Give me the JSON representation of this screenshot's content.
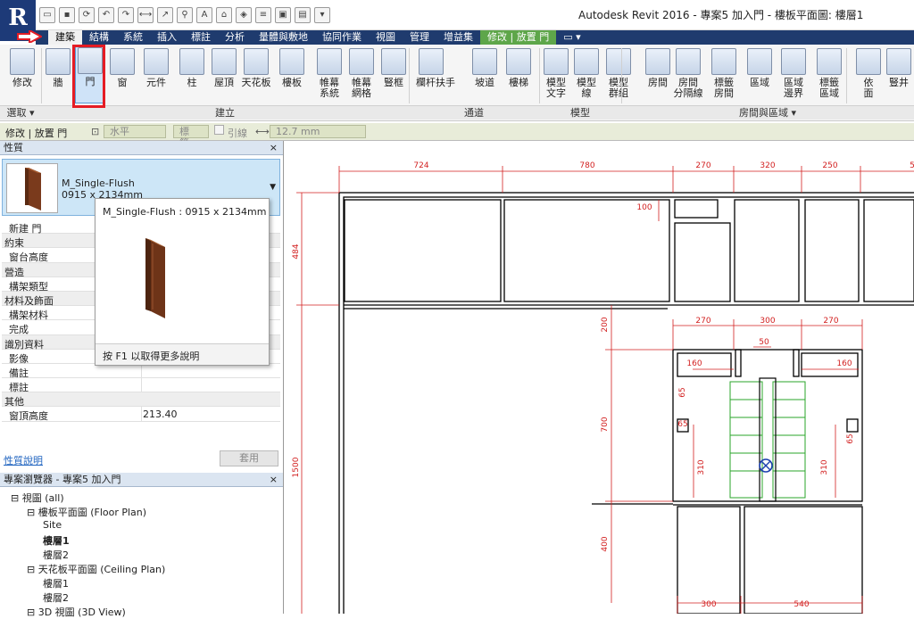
{
  "app": {
    "logo": "R",
    "window_title": "Autodesk Revit 2016 -   專案5 加入門 - 樓板平面圖: 樓層1"
  },
  "quick_access": [
    {
      "name": "open-icon",
      "glyph": "▭"
    },
    {
      "name": "save-icon",
      "glyph": "▪"
    },
    {
      "name": "sync-icon",
      "glyph": "⟳"
    },
    {
      "name": "undo-icon",
      "glyph": "↶"
    },
    {
      "name": "redo-icon",
      "glyph": "↷"
    },
    {
      "name": "measure-icon",
      "glyph": "⟷"
    },
    {
      "name": "dimension-icon",
      "glyph": "↗"
    },
    {
      "name": "tag-icon",
      "glyph": "⚲"
    },
    {
      "name": "text-icon",
      "glyph": "A"
    },
    {
      "name": "3d-icon",
      "glyph": "⌂"
    },
    {
      "name": "section-icon",
      "glyph": "◈"
    },
    {
      "name": "thin-lines-icon",
      "glyph": "≡"
    },
    {
      "name": "close-windows-icon",
      "glyph": "▣"
    },
    {
      "name": "switch-windows-icon",
      "glyph": "▤"
    },
    {
      "name": "customize-icon",
      "glyph": "▾"
    }
  ],
  "tabs": [
    "建築",
    "結構",
    "系統",
    "插入",
    "標註",
    "分析",
    "量體與敷地",
    "協同作業",
    "視圖",
    "管理",
    "增益集",
    "修改 | 放置 門",
    "▭ ▾"
  ],
  "ribbon": {
    "buttons": [
      {
        "id": "modify",
        "label": "修改"
      },
      {
        "id": "wall",
        "label": "牆"
      },
      {
        "id": "door",
        "label": "門"
      },
      {
        "id": "window",
        "label": "窗"
      },
      {
        "id": "component",
        "label": "元件"
      },
      {
        "id": "column",
        "label": "柱"
      },
      {
        "id": "roof",
        "label": "屋頂"
      },
      {
        "id": "ceiling",
        "label": "天花板"
      },
      {
        "id": "floor",
        "label": "樓板"
      },
      {
        "id": "curtain-system",
        "label": "帷幕\n系統"
      },
      {
        "id": "curtain-grid",
        "label": "帷幕\n網格"
      },
      {
        "id": "mullion",
        "label": "豎框"
      },
      {
        "id": "railing",
        "label": "欄杆扶手"
      },
      {
        "id": "ramp",
        "label": "坡道"
      },
      {
        "id": "stair",
        "label": "樓梯"
      },
      {
        "id": "model-text",
        "label": "模型\n文字"
      },
      {
        "id": "model-line",
        "label": "模型\n線"
      },
      {
        "id": "model-group",
        "label": "模型\n群組"
      },
      {
        "id": "room",
        "label": "房間"
      },
      {
        "id": "room-separator",
        "label": "房間\n分隔線"
      },
      {
        "id": "tag-room",
        "label": "標籤\n房間"
      },
      {
        "id": "area",
        "label": "區域"
      },
      {
        "id": "area-boundary",
        "label": "區域\n邊界"
      },
      {
        "id": "tag-area",
        "label": "標籤\n區域"
      },
      {
        "id": "by-face",
        "label": "依\n面"
      },
      {
        "id": "shaft",
        "label": "豎井"
      }
    ],
    "panels": [
      "選取 ▾",
      "建立",
      "通道",
      "模型",
      "房間與區域 ▾"
    ]
  },
  "options_bar": {
    "context": "修改 | 放置 門",
    "orientation": "水平",
    "tag_field": "標籤...",
    "leader_label": "引線",
    "leader_length": "12.7 mm"
  },
  "properties": {
    "title": "性質",
    "close": "×",
    "family_name": "M_Single-Flush",
    "family_size": "0915 x 2134mm",
    "instance_filter": "新建 門",
    "rows": [
      {
        "group": true,
        "key": "約束"
      },
      {
        "key": "窗台高度",
        "value": ""
      },
      {
        "group": true,
        "key": "營造"
      },
      {
        "key": "構架類型",
        "value": ""
      },
      {
        "group": true,
        "key": "材料及飾面"
      },
      {
        "key": "構架材料",
        "value": ""
      },
      {
        "key": "完成",
        "value": ""
      },
      {
        "group": true,
        "key": "識別資料"
      },
      {
        "key": "影像",
        "value": ""
      },
      {
        "key": "備註",
        "value": ""
      },
      {
        "key": "標註",
        "value": ""
      },
      {
        "group": true,
        "key": "其他"
      },
      {
        "key": "窗頂高度",
        "value": "213.40"
      }
    ],
    "help_link": "性質說明",
    "apply": "套用"
  },
  "tooltip": {
    "title": "M_Single-Flush : 0915 x 2134mm",
    "help": "按 F1 以取得更多說明"
  },
  "project_browser": {
    "title": "專案瀏覽器 - 專案5 加入門",
    "close": "×",
    "nodes": [
      {
        "text": "視圖 (all)",
        "level": 0,
        "selected": false
      },
      {
        "text": "樓板平面圖 (Floor Plan)",
        "level": 1,
        "selected": false
      },
      {
        "text": "Site",
        "level": 2,
        "selected": false
      },
      {
        "text": "樓層1",
        "level": 2,
        "selected": true
      },
      {
        "text": "樓層2",
        "level": 2,
        "selected": false
      },
      {
        "text": "天花板平面圖 (Ceiling Plan)",
        "level": 1,
        "selected": false
      },
      {
        "text": "樓層1",
        "level": 2,
        "selected": false
      },
      {
        "text": "樓層2",
        "level": 2,
        "selected": false
      },
      {
        "text": "3D 視圖 (3D View)",
        "level": 1,
        "selected": false
      }
    ]
  },
  "drawing": {
    "dims_top": [
      "724",
      "780",
      "270",
      "320",
      "250",
      "5"
    ],
    "dims_mid": [
      "270",
      "300",
      "270"
    ],
    "dims_inner": [
      "50",
      "160",
      "160",
      "65",
      "65",
      "65",
      "100"
    ],
    "dims_vertical": [
      "484",
      "1500",
      "200",
      "700",
      "310",
      "310",
      "400"
    ],
    "dims_bottom": [
      "300",
      "540"
    ],
    "colors": {
      "dimension": "#d21f1f",
      "stair": "#2aa52a",
      "tab_bar": "#1f3b6e",
      "context_tab": "#5ea64a"
    }
  }
}
